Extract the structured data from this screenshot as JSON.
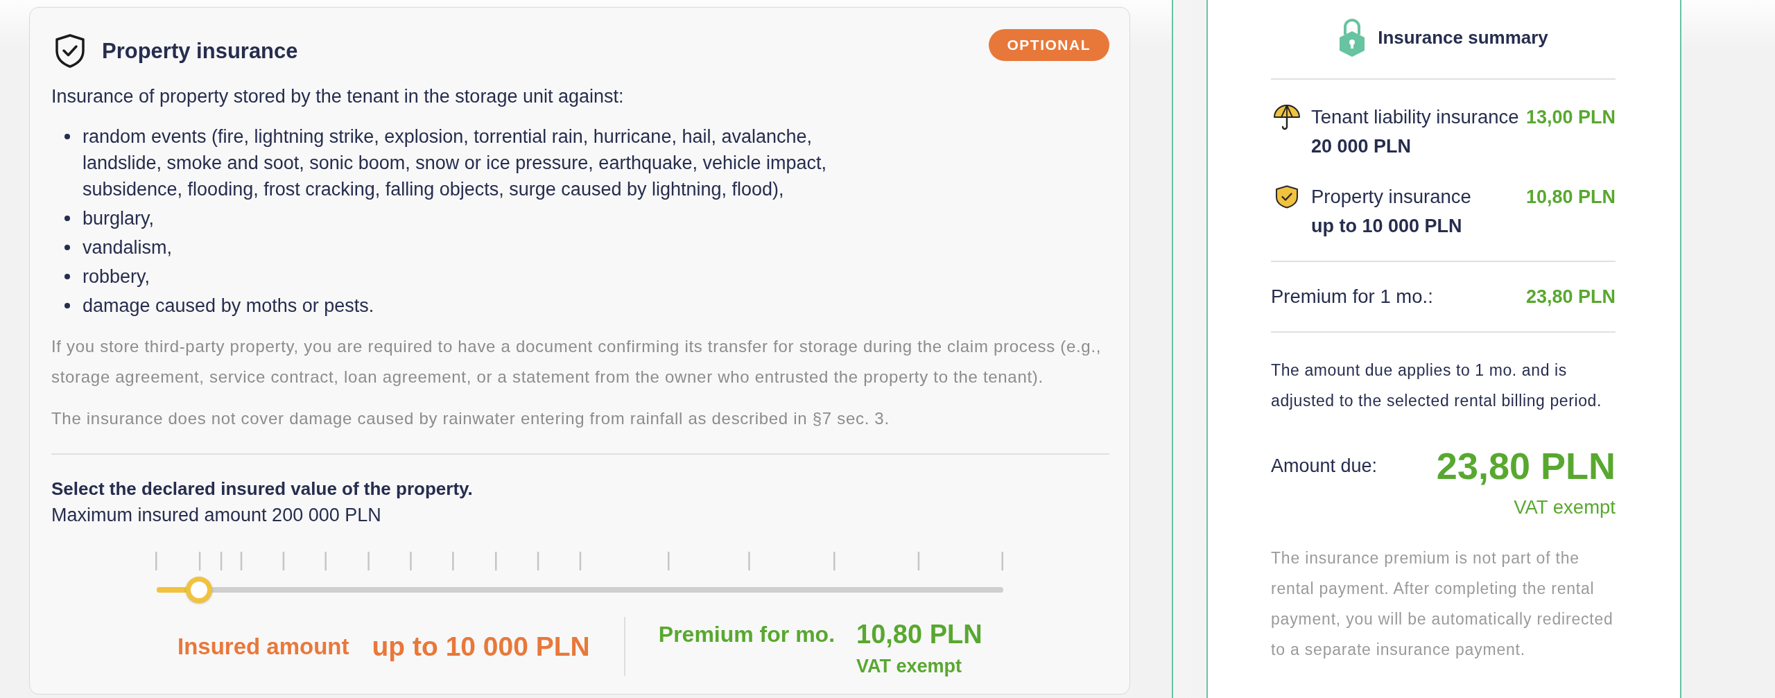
{
  "property_insurance": {
    "title": "Property insurance",
    "badge": "OPTIONAL",
    "intro": "Insurance of property stored by the tenant in the storage unit against:",
    "risks": [
      "random events (fire, lightning strike, explosion, torrential rain, hurricane, hail, avalanche, landslide, smoke and soot, sonic boom, snow or ice pressure, earthquake, vehicle impact, subsidence, flooding, frost cracking, falling objects, surge caused by lightning, flood),",
      "burglary,",
      "vandalism,",
      "robbery,",
      "damage caused by moths or pests."
    ],
    "notes": [
      "If you store third-party property, you are required to have a document confirming its transfer for storage during the claim process (e.g., storage agreement, service contract, loan agreement, or a statement from the owner who entrusted the property to the tenant).",
      "The insurance does not cover damage caused by rainwater entering from rainfall as described in §7 sec. 3."
    ],
    "value_selector": {
      "heading": "Select the declared insured value of the property.",
      "subheading": "Maximum insured amount 200 000 PLN",
      "slider": {
        "level": 0.05
      },
      "insured_amount_label": "Insured amount",
      "insured_amount": "up to 10 000 PLN",
      "premium_label": "Premium for mo.",
      "premium": "10,80 PLN",
      "vat_note": "VAT exempt"
    }
  },
  "insurance_summary": {
    "title": "Insurance summary",
    "coverages": [
      {
        "name": "Tenant liability insurance",
        "amount": "20 000 PLN",
        "price": "13,00 PLN"
      },
      {
        "name": "Property insurance",
        "amount": "up to 10 000 PLN",
        "price": "10,80 PLN"
      }
    ],
    "premium_label": "Premium for 1 mo.:",
    "premium": "23,80 PLN",
    "billing_note": "The amount due applies to 1 mo. and is adjusted to the selected rental billing period.",
    "amount_due_label": "Amount due:",
    "amount_due": "23,80 PLN",
    "vat_note": "VAT exempt",
    "payment_note": "The insurance premium is not part of the rental payment. After completing the rental payment, you will be automatically redirected to a separate insurance payment."
  }
}
